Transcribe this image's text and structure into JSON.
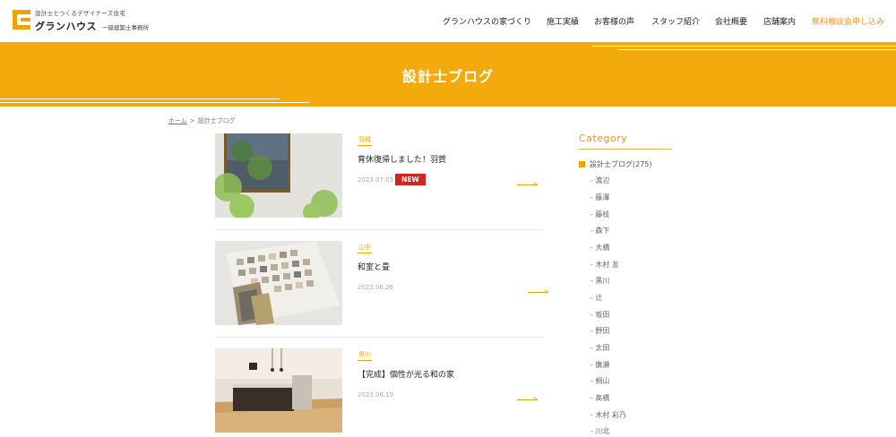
{
  "header": {
    "logo_tagline": "設計士とつくるデザイナーズ住宅",
    "logo_name": "グランハウス",
    "logo_sub": "一級建築士事務所",
    "nav": [
      {
        "label": "グランハウスの家づくり"
      },
      {
        "label": "施工実績"
      },
      {
        "label": "お客様の声"
      },
      {
        "label": "スタッフ紹介"
      },
      {
        "label": "会社概要"
      },
      {
        "label": "店舗案内"
      },
      {
        "label": "無料相談会申し込み"
      }
    ]
  },
  "banner": {
    "title": "設計士ブログ"
  },
  "breadcrumb": {
    "home": "ホーム",
    "separator": ">",
    "current": "設計士ブログ"
  },
  "posts": [
    {
      "tag": "羽賀",
      "title": "育休復帰しました！羽賀",
      "date": "2023.07.03",
      "badge": "NEW",
      "thumb": "window-plant-photo"
    },
    {
      "tag": "山中",
      "title": "和室と畳",
      "date": "2023.06.26",
      "thumb": "tile-samples-photo"
    },
    {
      "tag": "黒川",
      "title": "【完成】個性が光る和の家",
      "date": "2023.06.19",
      "thumb": "kitchen-interior-photo"
    }
  ],
  "sidebar": {
    "heading": "Category",
    "main_category": "設計士ブログ(275)",
    "subcategories": [
      "- 渡辺",
      "- 藤澤",
      "- 藤枝",
      "- 森下",
      "- 大橋",
      "- 木村 友",
      "- 黒川",
      "- 辻",
      "- 坂田",
      "- 野田",
      "- 太田",
      "- 廣瀬",
      "- 桐山",
      "- 髙橋",
      "- 木村 彩乃",
      "- 川北"
    ]
  },
  "colors": {
    "accent": "#f2aa0c",
    "cta": "#e8932a",
    "new_badge": "#d2251e"
  }
}
